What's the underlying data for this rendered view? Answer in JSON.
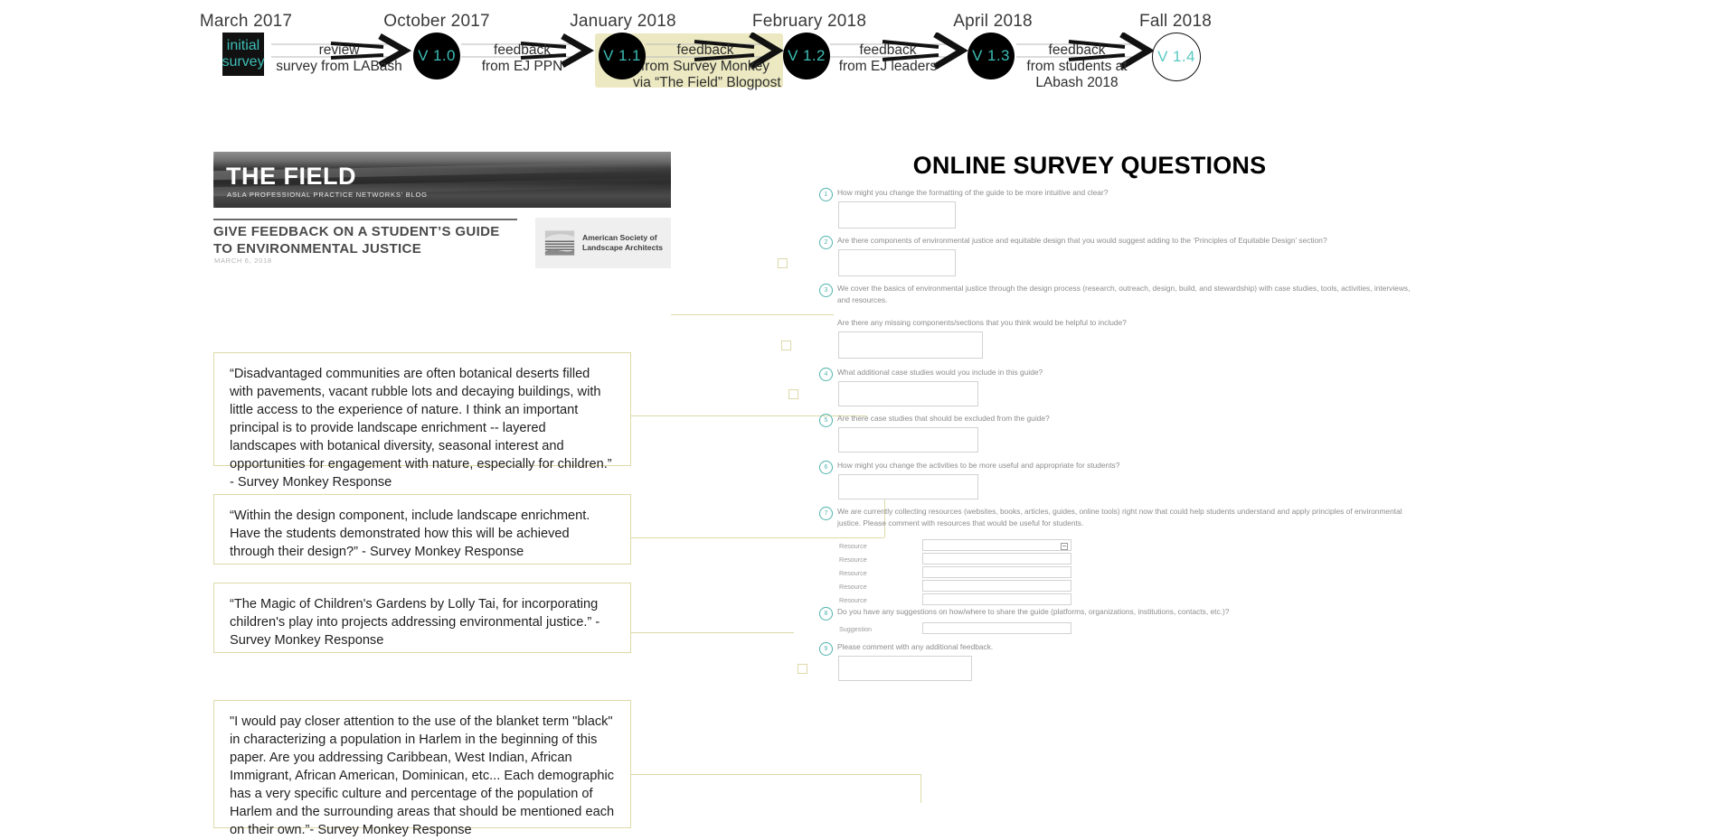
{
  "timeline": {
    "nodes": [
      {
        "id": "initial-survey",
        "date": "March 2017",
        "label_line1": "initial",
        "label_line2": "survey",
        "shape": "square"
      },
      {
        "id": "v10",
        "date": "October 2017",
        "label": "V 1.0",
        "shape": "circle"
      },
      {
        "id": "v11",
        "date": "January 2018",
        "label": "V 1.1",
        "shape": "circle",
        "highlighted": true
      },
      {
        "id": "v12",
        "date": "February 2018",
        "label": "V 1.2",
        "shape": "circle"
      },
      {
        "id": "v13",
        "date": "April 2018",
        "label": "V 1.3",
        "shape": "circle"
      },
      {
        "id": "v14",
        "date": "Fall 2018",
        "label": "V 1.4",
        "shape": "circle-hollow"
      }
    ],
    "arrows": [
      {
        "line1": "review",
        "line2": "survey from LABash",
        "line3": ""
      },
      {
        "line1": "feedback",
        "line2": "from EJ PPN",
        "line3": ""
      },
      {
        "line1": "feedback",
        "line2": "from Survey Monkey",
        "line3": "via “The Field” Blogpost"
      },
      {
        "line1": "feedback",
        "line2": "from EJ leaders",
        "line3": ""
      },
      {
        "line1": "feedback",
        "line2": "from students at",
        "line3": "LAbash 2018"
      }
    ],
    "colors": {
      "node_fill": "#000000",
      "node_text": "#3cbdb5",
      "highlight": "#ece9c2",
      "date_text": "#3a3a3a"
    }
  },
  "blog": {
    "banner_title": "THE FIELD",
    "banner_subtitle": "ASLA PROFESSIONAL PRACTICE NETWORKS' BLOG",
    "post_title": "GIVE FEEDBACK ON A STUDENT’S GUIDE TO ENVIRONMENTAL JUSTICE",
    "post_date": "MARCH 6, 2018",
    "logo_line1": "American Society of",
    "logo_line2": "Landscape Architects"
  },
  "quotes": [
    {
      "id": "quote-1",
      "text": "“Disadvantaged communities are often botanical deserts filled with pavements, vacant rubble lots and decaying buildings, with little access to the experience of nature. I think an important principal is to provide landscape enrichment -- layered landscapes with botanical diversity, seasonal interest and opportunities for engagement with nature, especially for children.” - Survey Monkey Response"
    },
    {
      "id": "quote-2",
      "text": "“Within the design component, include landscape enrichment. Have the students demonstrated how this will be achieved through their design?” - Survey Monkey Response"
    },
    {
      "id": "quote-3",
      "text": "“The Magic of Children's Gardens by Lolly Tai, for incorporating children's play into projects addressing environmental justice.” - Survey Monkey Response"
    },
    {
      "id": "quote-4",
      "text": "\"I would pay closer attention to the use of the blanket term \"black\" in characterizing a population in Harlem in the beginning of this paper. Are you addressing Caribbean, West Indian, African Immigrant, African American, Dominican, etc... Each demographic has a very specific culture and percentage of the population of Harlem and the surrounding areas that should be mentioned each on their own.”- Survey Monkey Response"
    }
  ],
  "survey": {
    "title": "ONLINE SURVEY QUESTIONS",
    "questions": [
      {
        "num": "1",
        "text": "How might you change the formatting of the guide to be more intuitive and clear?",
        "sub": ""
      },
      {
        "num": "2",
        "text": "Are there components of environmental justice and equitable design that you would suggest adding to the ‘Principles of Equitable Design’ section?",
        "sub": ""
      },
      {
        "num": "3",
        "text": "We cover the basics of environmental justice through the design process (research, outreach, design, build, and stewardship) with case studies, tools, activities, interviews, and resources.",
        "sub": "Are there any missing components/sections that you think would be helpful to include?"
      },
      {
        "num": "4",
        "text": "What additional case studies would you include in this guide?",
        "sub": ""
      },
      {
        "num": "5",
        "text": "Are there case studies that should be excluded from the guide?",
        "sub": ""
      },
      {
        "num": "6",
        "text": "How might you change the activities to be more useful and appropriate for students?",
        "sub": ""
      },
      {
        "num": "7",
        "text": "We are currently collecting resources (websites, books, articles, guides, online tools) right now that could help students understand and apply principles of environmental justice. Please comment with resources that would be useful for students.",
        "sub": ""
      },
      {
        "num": "8",
        "text": "Do you have any suggestions on how/where to share the guide (platforms, organizations, institutions, contacts, etc.)?",
        "sub": ""
      },
      {
        "num": "9",
        "text": "Please comment with any additional feedback.",
        "sub": ""
      }
    ],
    "resource_labels": [
      "Resource",
      "Resource",
      "Resource",
      "Resource",
      "Resource"
    ],
    "suggestion_label": "Suggestion",
    "answer_value": "",
    "accent_color": "#4fb3ae",
    "connector_color": "#ddd9a8"
  }
}
